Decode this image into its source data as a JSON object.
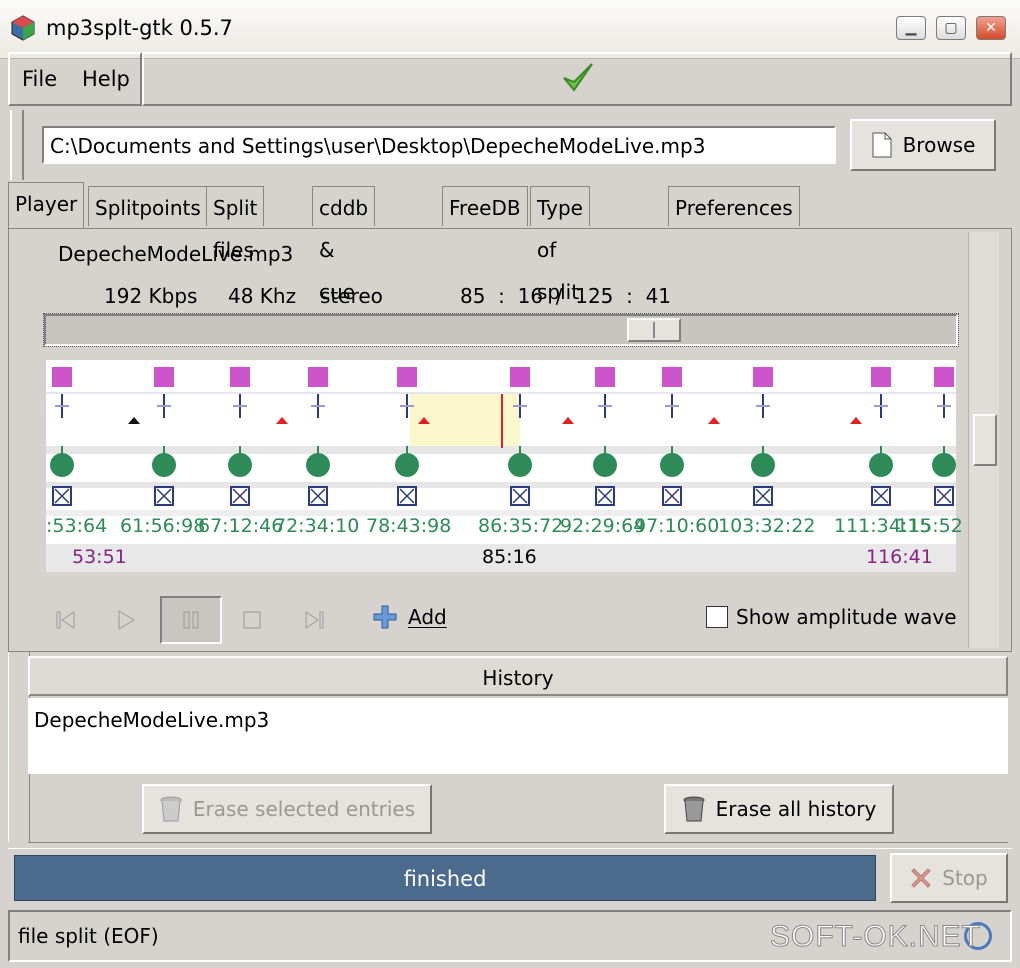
{
  "window": {
    "title": "mp3splt-gtk 0.5.7"
  },
  "menu": {
    "file": "File",
    "help": "Help"
  },
  "file": {
    "path": "C:\\Documents and Settings\\user\\Desktop\\DepecheModeLive.mp3",
    "browse": "Browse"
  },
  "tabs": [
    "Player",
    "Splitpoints",
    "Split files",
    "cddb & cue",
    "FreeDB",
    "Type of split",
    "Preferences"
  ],
  "player": {
    "filename": "DepecheModeLive.mp3",
    "bitrate": "192 Kbps",
    "frequency": "48 Khz",
    "mode": "stereo",
    "time": "85  :  16  /  125  :  41",
    "seek_fraction": 0.68,
    "splitpoint_labels": [
      ":53:64",
      "61:56:98",
      "67:12:46",
      "72:34:10",
      "78:43:98",
      "86:35:72",
      "92:29:64",
      "97:10:60",
      "103:32:22",
      "111:34:15",
      "115:52"
    ],
    "start_time": "53:51",
    "current_time": "85:16",
    "end_time": "116:41",
    "add_label": "Add",
    "amplitude_label": "Show amplitude wave"
  },
  "history": {
    "header": "History",
    "entries": [
      "DepecheModeLive.mp3"
    ],
    "erase_selected": "Erase selected entries",
    "erase_all": "Erase all history"
  },
  "progress": {
    "text": "finished",
    "stop": "Stop"
  },
  "status": {
    "text": "file split (EOF)"
  },
  "watermark": "SOFT-OK.NET",
  "colors": {
    "splitpoint": "#cc55cc",
    "segment": "#2e8b57",
    "progress": "#4c6a8c",
    "cursor": "#dd2222"
  }
}
